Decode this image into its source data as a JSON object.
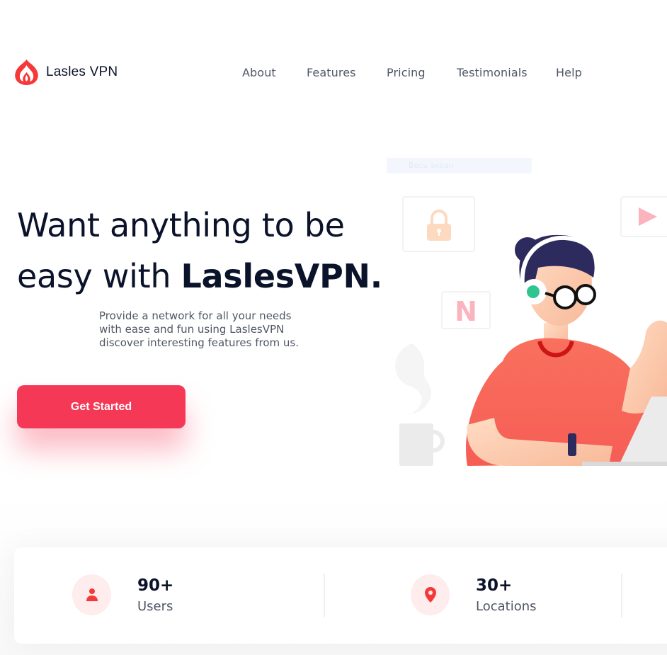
{
  "brand": {
    "name": "Lasles VPN",
    "accent": "#f53855"
  },
  "nav": {
    "items": [
      "About",
      "Features",
      "Pricing",
      "Testimonials",
      "Help"
    ]
  },
  "hero": {
    "title_line1": "Want anything to be",
    "title_line2_prefix": "easy with ",
    "title_line2_bold": "LaslesVPN.",
    "subtitle_line1": "Provide a network for all your needs",
    "subtitle_line2": "with ease and fun using LaslesVPN",
    "subtitle_line3": "discover interesting features from us.",
    "cta_label": "Get Started",
    "overlay_text": "Весь экран"
  },
  "illustration": {
    "lock_icon": "lock-icon",
    "netflix_tile": "N",
    "play_icon": "play-icon"
  },
  "stats": [
    {
      "value": "90+",
      "label": "Users",
      "icon": "user-icon"
    },
    {
      "value": "30+",
      "label": "Locations",
      "icon": "location-pin-icon"
    }
  ]
}
